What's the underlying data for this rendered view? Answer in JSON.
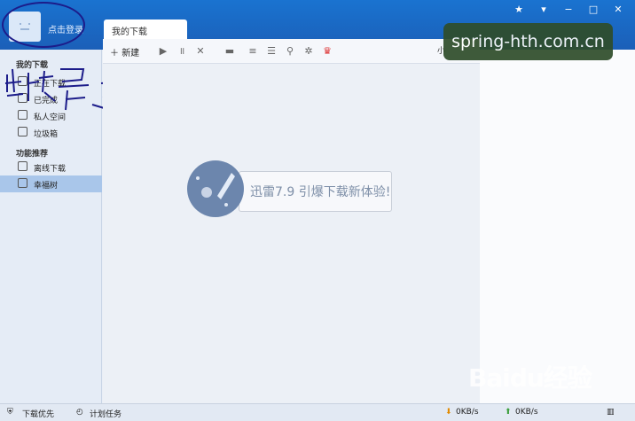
{
  "header": {
    "login_text": "点击登录",
    "tab_label": "我的下载",
    "window_buttons": [
      "★",
      "▾",
      "−",
      "□",
      "✕"
    ]
  },
  "watermark": "spring-hth.com.cn",
  "sidebar": {
    "section_downloads": "我的下载",
    "items": [
      {
        "label": "正在下载"
      },
      {
        "label": "已完成"
      },
      {
        "label": "私人空间"
      },
      {
        "label": "垃圾箱"
      }
    ],
    "section_features": "功能推荐",
    "features": [
      {
        "label": "离线下载"
      },
      {
        "label": "幸福树"
      }
    ]
  },
  "toolbar": {
    "new_label": "新建",
    "small_view": "小"
  },
  "empty_state": {
    "message": "迅雷7.9 引爆下载新体验!"
  },
  "status": {
    "priority": "下载优先",
    "schedule": "计划任务",
    "download_speed": "0KB/s",
    "upload_speed": "0KB/s"
  },
  "handwritten_text": "点击登录",
  "baidu_logo": "Baidu经验"
}
